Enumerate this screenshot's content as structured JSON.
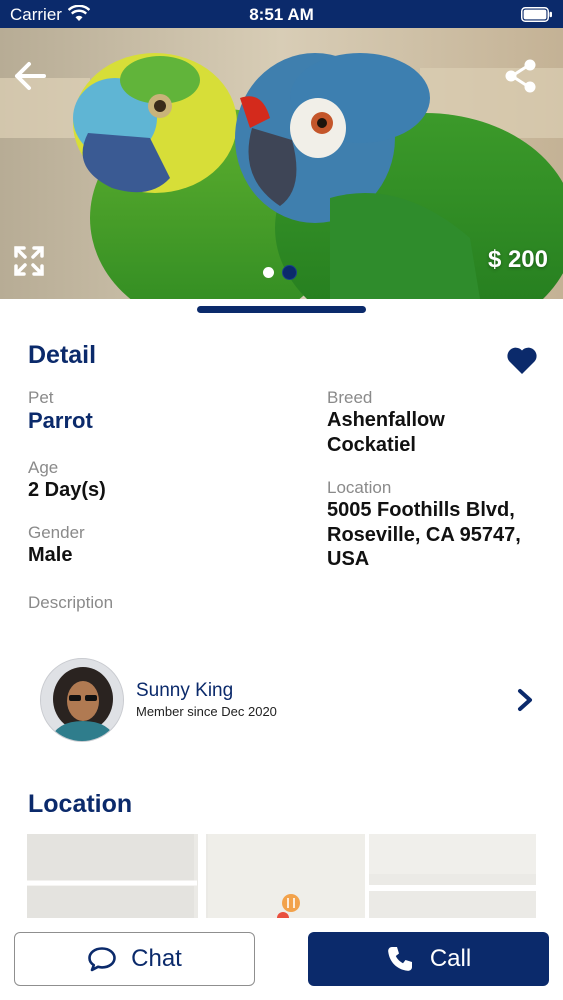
{
  "status_bar": {
    "carrier": "Carrier",
    "time": "8:51 AM",
    "icons": [
      "wifi-icon",
      "battery-icon"
    ]
  },
  "hero": {
    "price": "$ 200",
    "image_count": 2,
    "active_image_index": 1,
    "icons": [
      "back-arrow-icon",
      "share-icon",
      "expand-icon"
    ]
  },
  "detail": {
    "title": "Detail",
    "favorite_icon": "heart-icon",
    "pet_label": "Pet",
    "pet_value": "Parrot",
    "age_label": "Age",
    "age_value": "2 Day(s)",
    "gender_label": "Gender",
    "gender_value": "Male",
    "description_label": "Description",
    "breed_label": "Breed",
    "breed_line1": "Ashenfallow",
    "breed_line2": "Cockatiel",
    "location_label": "Location",
    "location_line1": "5005 Foothills Blvd,",
    "location_line2": "Roseville, CA 95747,",
    "location_line3": "USA"
  },
  "seller": {
    "name": "Sunny King",
    "member_since": "Member since Dec 2020",
    "chevron_icon": "chevron-right-icon"
  },
  "location_section": {
    "title": "Location"
  },
  "actions": {
    "chat_label": "Chat",
    "call_label": "Call",
    "chat_icon": "chat-bubble-icon",
    "call_icon": "phone-icon"
  },
  "colors": {
    "primary": "#0b2a6b",
    "label_gray": "#8a8a8a",
    "white": "#ffffff"
  }
}
